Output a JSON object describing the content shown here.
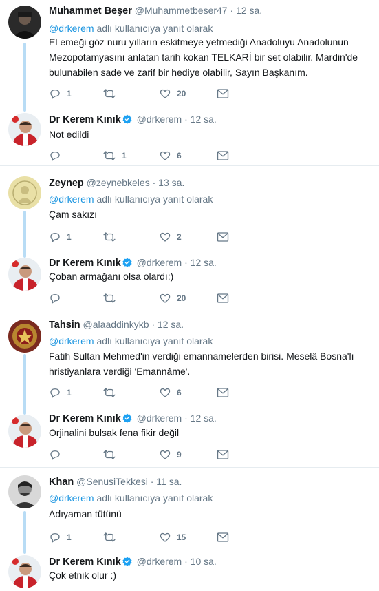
{
  "reply_prefix": "adlı kullanıcıya yanıt olarak",
  "colors": {
    "link": "#1b95e0",
    "muted": "#657786",
    "text": "#14171a",
    "thread_line": "#b8dcf5",
    "divider": "#e6ecf0"
  },
  "tweets": [
    {
      "name": "Muhammet Beşer",
      "handle": "@Muhammetbeser47",
      "time": "12 sa.",
      "reply_to": "@drkerem",
      "text": "El emeği göz nuru yılların eskitmeye yetmediği Anadoluyu Anadolunun Mezopotamyasını anlatan tarih kokan TELKARİ bir set olabilir. Mardin'de bulunabilen sade ve zarif bir hediye olabilir, Sayın Başkanım.",
      "replies": "1",
      "retweets": "",
      "likes": "20"
    },
    {
      "name": "Dr Kerem Kınık",
      "handle": "@drkerem",
      "time": "12 sa.",
      "verified": true,
      "text": "Not edildi",
      "replies": "",
      "retweets": "1",
      "likes": "6"
    },
    {
      "name": "Zeynep",
      "handle": "@zeynebkeles",
      "time": "13 sa.",
      "reply_to": "@drkerem",
      "text": "Çam sakızı",
      "replies": "1",
      "retweets": "",
      "likes": "2"
    },
    {
      "name": "Dr Kerem Kınık",
      "handle": "@drkerem",
      "time": "12 sa.",
      "verified": true,
      "text": "Çoban armağanı olsa olardı:)",
      "replies": "",
      "retweets": "",
      "likes": "20"
    },
    {
      "name": "Tahsin",
      "handle": "@alaaddinkykb",
      "time": "12 sa.",
      "reply_to": "@drkerem",
      "text": "Fatih Sultan Mehmed'in verdiği emannamelerden birisi. Meselâ Bosna'lı hristiyanlara verdiği 'Emannâme'.",
      "replies": "1",
      "retweets": "",
      "likes": "6"
    },
    {
      "name": "Dr Kerem Kınık",
      "handle": "@drkerem",
      "time": "12 sa.",
      "verified": true,
      "text": "Orjinalini bulsak fena fikir değil",
      "replies": "",
      "retweets": "",
      "likes": "9"
    },
    {
      "name": "Khan",
      "handle": "@SenusiTekkesi",
      "time": "11 sa.",
      "reply_to": "@drkerem",
      "text": "Adıyaman tütünü",
      "replies": "1",
      "retweets": "",
      "likes": "15"
    },
    {
      "name": "Dr Kerem Kınık",
      "handle": "@drkerem",
      "time": "10 sa.",
      "verified": true,
      "text": "Çok etnik olur :)",
      "replies": "",
      "retweets": "",
      "likes": ""
    }
  ]
}
